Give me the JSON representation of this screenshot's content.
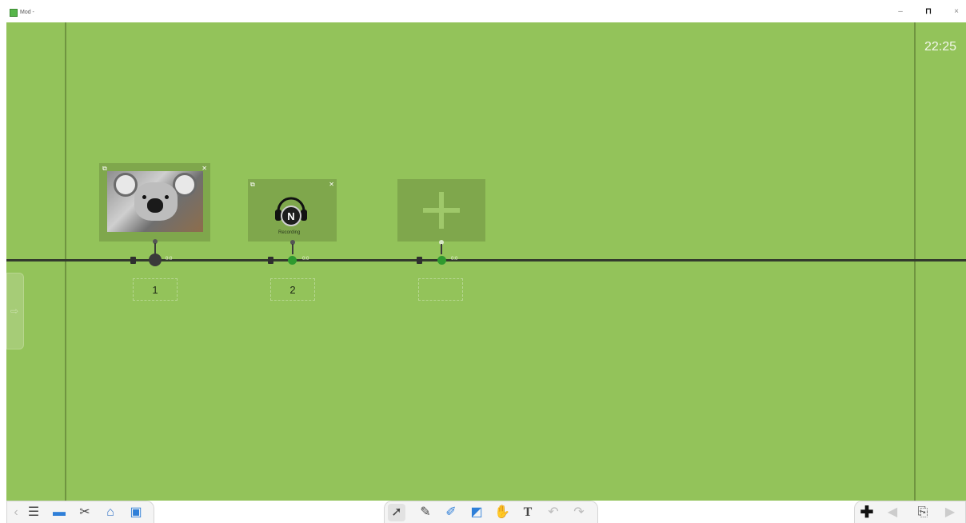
{
  "app": {
    "title": "Mod -",
    "window_controls": {
      "minimize": "–",
      "maximize": "⊓",
      "close": "×"
    }
  },
  "colors": {
    "canvas": "#93c35a",
    "card": "#7fa74c",
    "timeline": "#333a2d",
    "active_node": "#2f9a2f"
  },
  "canvas": {
    "clock": "22:25",
    "side_handle_icon": "arrow-right-icon"
  },
  "timeline": {
    "items": [
      {
        "number": "1",
        "thumbnail": "koala-photo",
        "time_label": "0:0"
      },
      {
        "number": "2",
        "thumbnail": "headphones-audio-icon",
        "audio_label": "Recording",
        "time_label": "0:0"
      },
      {
        "number": "",
        "thumbnail": "add-plus-icon",
        "time_label": "0:0"
      }
    ]
  },
  "toolbar_left": {
    "icons": [
      "chevron-left-icon",
      "menu-icon",
      "screen-icon",
      "tools-icon",
      "cabinet-icon",
      "image-icon"
    ]
  },
  "toolbar_center": {
    "icons": [
      "select-arrow-icon",
      "pen-icon",
      "highlighter-icon",
      "eraser-icon",
      "hand-icon",
      "text-icon",
      "undo-icon",
      "redo-icon"
    ],
    "text_tool": "T"
  },
  "toolbar_right": {
    "icons": [
      "add-page-icon",
      "previous-page-icon",
      "page-sorter-icon",
      "next-page-icon"
    ]
  }
}
